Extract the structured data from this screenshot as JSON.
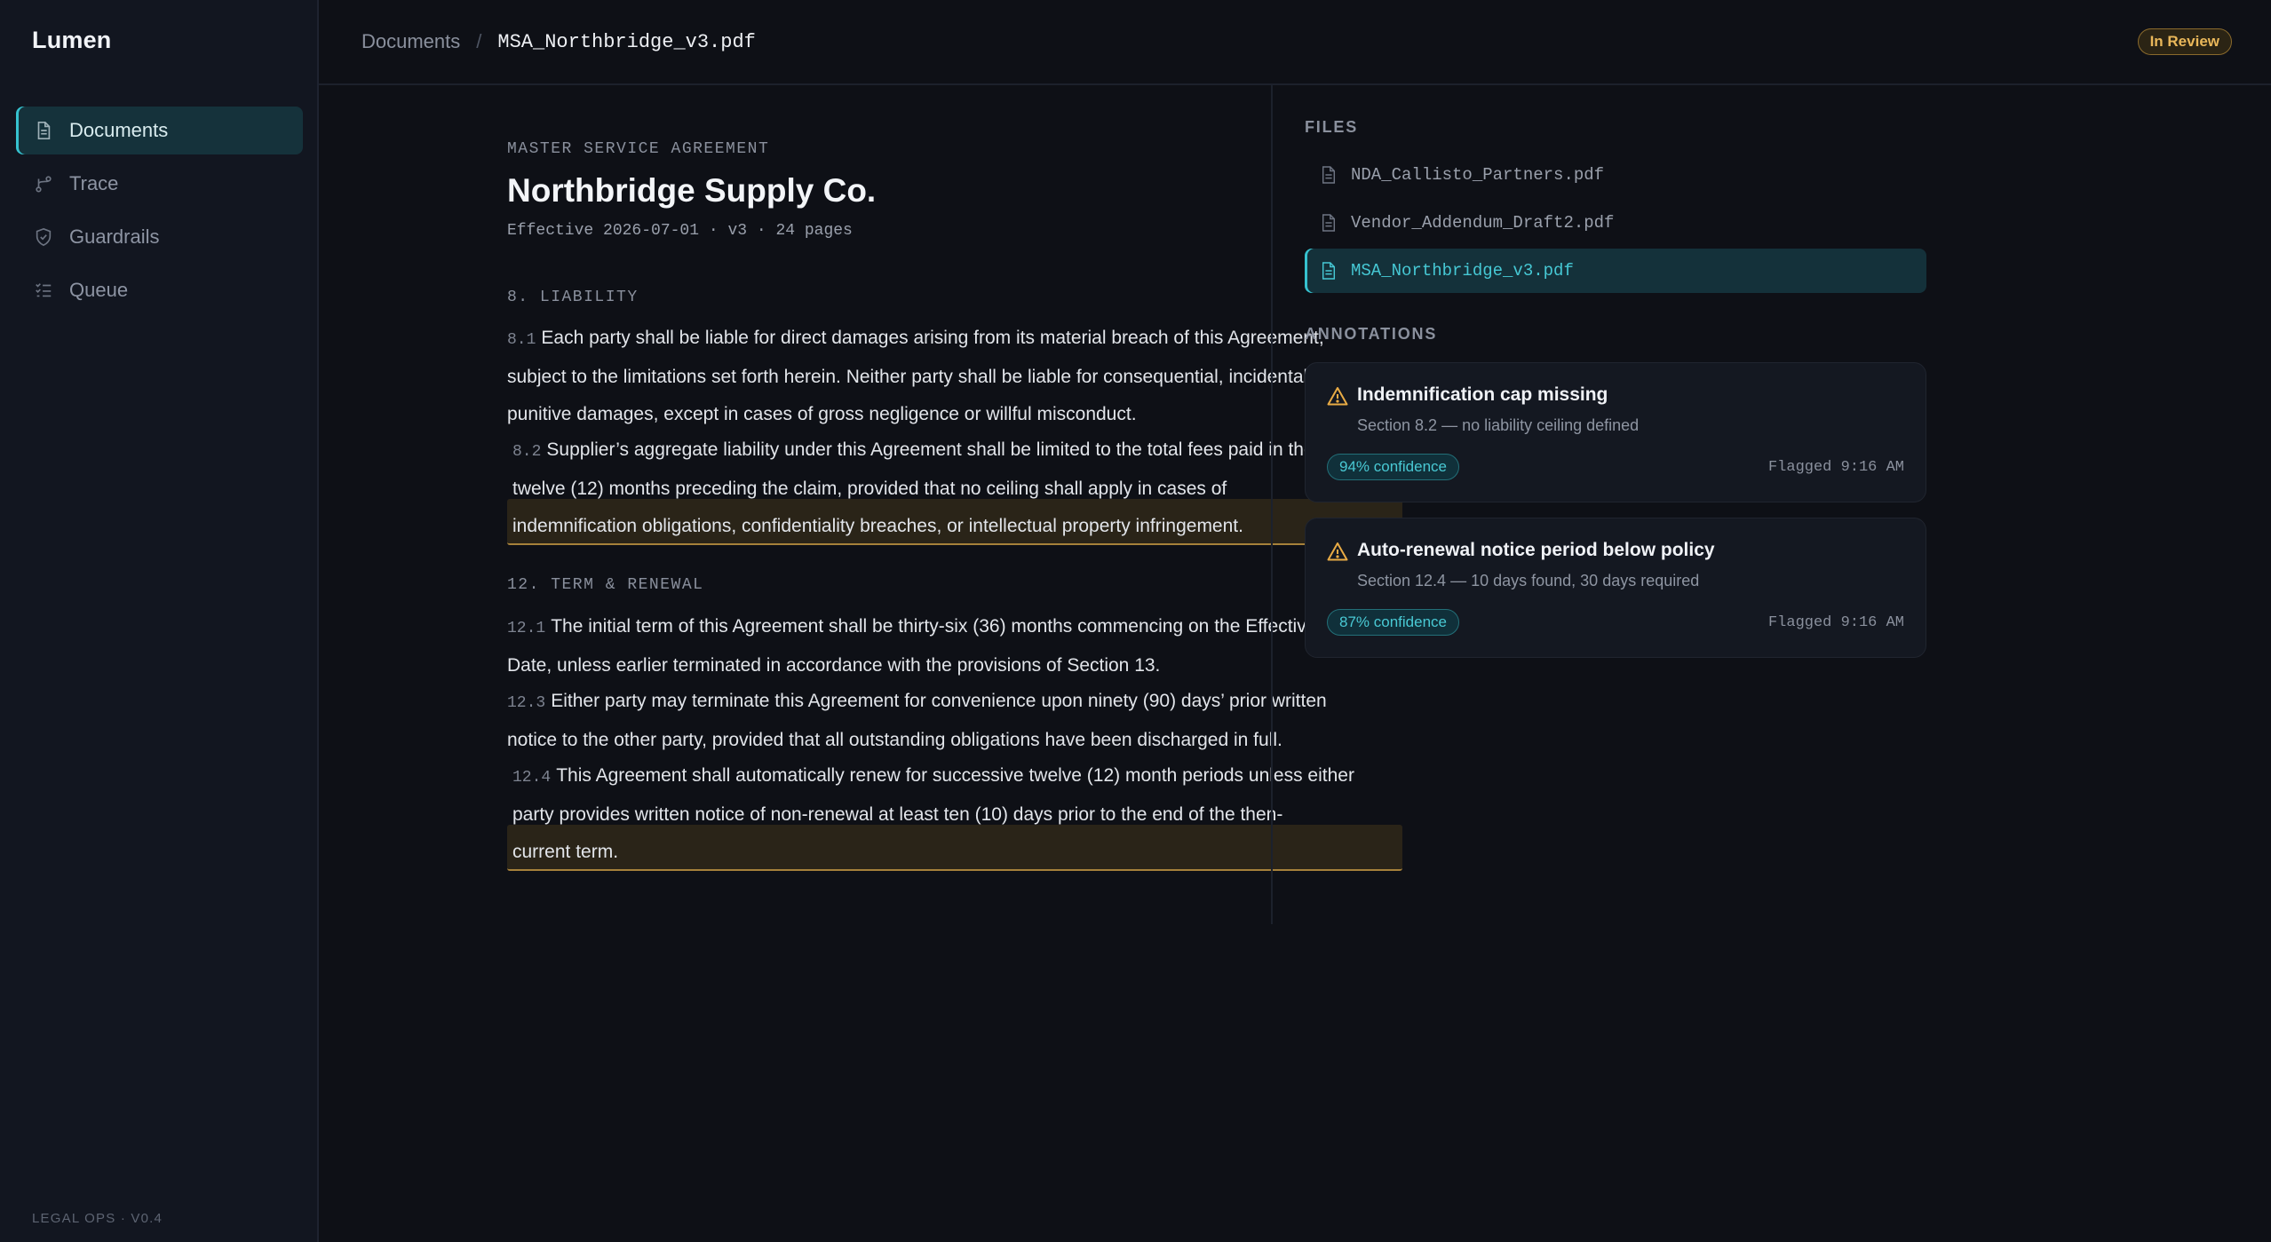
{
  "app": {
    "name": "Lumen",
    "footer": "LEGAL OPS · V0.4"
  },
  "nav": [
    {
      "label": "Documents",
      "icon": "document-icon",
      "active": true
    },
    {
      "label": "Trace",
      "icon": "branch-icon"
    },
    {
      "label": "Guardrails",
      "icon": "shield-icon"
    },
    {
      "label": "Queue",
      "icon": "list-check-icon"
    }
  ],
  "breadcrumb": {
    "root": "Documents",
    "separator": "/",
    "current": "MSA_Northbridge_v3.pdf"
  },
  "status": "In Review",
  "document": {
    "kicker": "MASTER SERVICE AGREEMENT",
    "title": "Northbridge Supply Co.",
    "meta": "Effective 2026-07-01 · v3 · 24 pages",
    "sections": [
      {
        "heading": "8. LIABILITY",
        "clauses": [
          {
            "num": "8.1",
            "line1": "Each party shall be liable for direct damages arising from its material breach of this Agreement,",
            "line2": "subject to the limitations set forth herein. Neither party shall be liable for consequential, incidental, or",
            "line3": "punitive damages, except in cases of gross negligence or willful misconduct."
          },
          {
            "num": "8.2",
            "line1": "Supplier’s aggregate liability under this Agreement shall be limited to the total fees paid in the",
            "line2": "twelve (12) months preceding the claim, provided that no ceiling shall apply in cases of",
            "line3": "indemnification obligations, confidentiality breaches, or intellectual property infringement."
          }
        ]
      },
      {
        "heading": "12. TERM & RENEWAL",
        "clauses": [
          {
            "num": "12.1",
            "line1": "The initial term of this Agreement shall be thirty-six (36) months commencing on the Effective",
            "line2": "Date, unless earlier terminated in accordance with the provisions of Section 13."
          },
          {
            "num": "12.3",
            "line1": "Either party may terminate this Agreement for convenience upon ninety (90) days’ prior written",
            "line2": "notice to the other party, provided that all outstanding obligations have been discharged in full."
          },
          {
            "num": "12.4",
            "line1": "This Agreement shall automatically renew for successive twelve (12) month periods unless either",
            "line2": "party provides written notice of non-renewal at least ten (10) days prior to the end of the then-",
            "line3": "current term."
          }
        ]
      }
    ]
  },
  "files": {
    "label": "FILES",
    "items": [
      {
        "name": "NDA_Callisto_Partners.pdf"
      },
      {
        "name": "Vendor_Addendum_Draft2.pdf"
      },
      {
        "name": "MSA_Northbridge_v3.pdf",
        "active": true
      }
    ]
  },
  "annotations": {
    "label": "ANNOTATIONS",
    "items": [
      {
        "title": "Indemnification cap missing",
        "detail": "Section 8.2 — no liability ceiling defined",
        "confidence": "94% confidence",
        "flagged": "Flagged 9:16 AM"
      },
      {
        "title": "Auto-renewal notice period below policy",
        "detail": "Section 12.4 — 10 days found, 30 days required",
        "confidence": "87% confidence",
        "flagged": "Flagged 9:16 AM"
      }
    ]
  },
  "colors": {
    "accent": "#36c2cf",
    "warning": "#e9ab45",
    "highlight": "#a6813a",
    "background": "#0e1016"
  }
}
